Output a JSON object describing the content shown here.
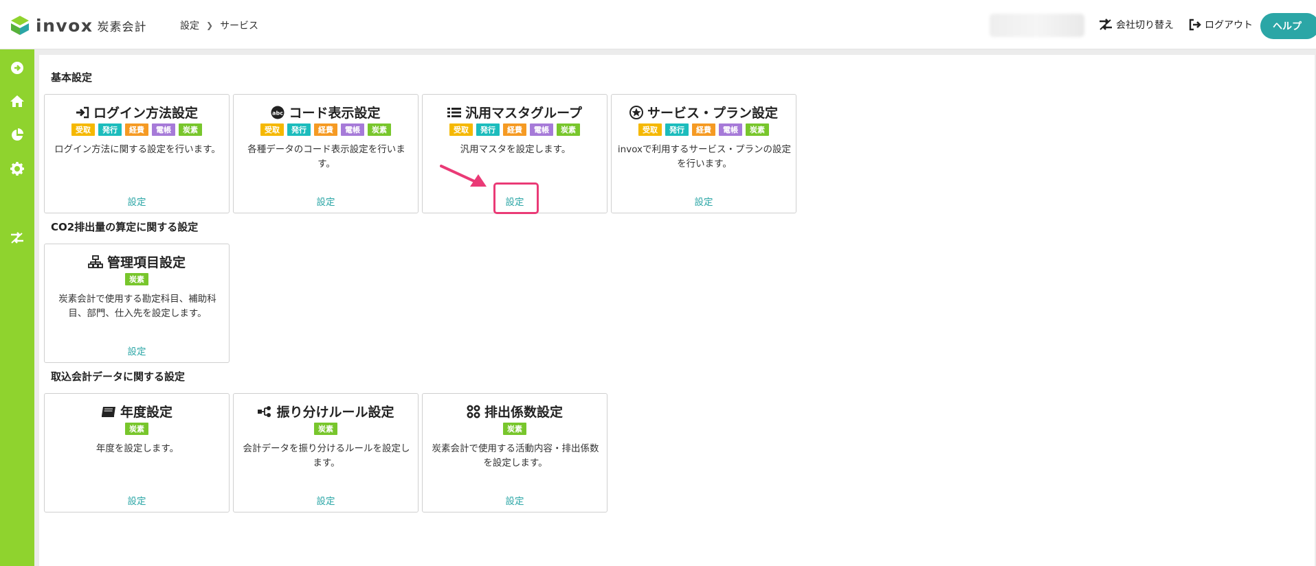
{
  "header": {
    "logo_word": "invox",
    "logo_sub": "炭素会計",
    "breadcrumb": [
      "設定",
      "サービス"
    ],
    "switch_company": "会社切り替え",
    "logout": "ログアウト",
    "help": "ヘルプ"
  },
  "sidebar": {
    "icons": [
      "arrow-right-circle-icon",
      "home-icon",
      "pie-chart-icon",
      "gear-icon",
      "switch-icon"
    ]
  },
  "tag_colors": {
    "受取": "#f5b800",
    "発行": "#1cbcbc",
    "経費": "#f59a23",
    "電帳": "#a67ad8",
    "炭素": "#78c62c"
  },
  "sections": [
    {
      "title": "基本設定",
      "cards": [
        {
          "icon": "login-icon",
          "title": "ログイン方法設定",
          "tags": [
            "受取",
            "発行",
            "経費",
            "電帳",
            "炭素"
          ],
          "desc": "ログイン方法に関する設定を行います。",
          "link": "設定"
        },
        {
          "icon": "abc-icon",
          "title": "コード表示設定",
          "tags": [
            "受取",
            "発行",
            "経費",
            "電帳",
            "炭素"
          ],
          "desc": "各種データのコード表示設定を行います。",
          "link": "設定"
        },
        {
          "icon": "list-icon",
          "title": "汎用マスタグループ",
          "tags": [
            "受取",
            "発行",
            "経費",
            "電帳",
            "炭素"
          ],
          "desc": "汎用マスタを設定します。",
          "link": "設定"
        },
        {
          "icon": "star-badge-icon",
          "title": "サービス・プラン設定",
          "tags": [
            "受取",
            "発行",
            "経費",
            "電帳",
            "炭素"
          ],
          "desc": "invoxで利用するサービス・プランの設定を行います。",
          "link": "設定"
        }
      ]
    },
    {
      "title": "CO2排出量の算定に関する設定",
      "cards": [
        {
          "icon": "sitemap-icon",
          "title": "管理項目設定",
          "tags": [
            "炭素"
          ],
          "desc": "炭素会計で使用する勘定科目、補助科目、部門、仕入先を設定します。",
          "link": "設定"
        }
      ]
    },
    {
      "title": "取込会計データに関する設定",
      "cards": [
        {
          "icon": "calendar-book-icon",
          "title": "年度設定",
          "tags": [
            "炭素"
          ],
          "desc": "年度を設定します。",
          "link": "設定"
        },
        {
          "icon": "split-icon",
          "title": "振り分けルール設定",
          "tags": [
            "炭素"
          ],
          "desc": "会計データを振り分けるルールを設定します。",
          "link": "設定"
        },
        {
          "icon": "grid-circles-icon",
          "title": "排出係数設定",
          "tags": [
            "炭素"
          ],
          "desc": "炭素会計で使用する活動内容・排出係数を設定します。",
          "link": "設定"
        }
      ]
    }
  ]
}
